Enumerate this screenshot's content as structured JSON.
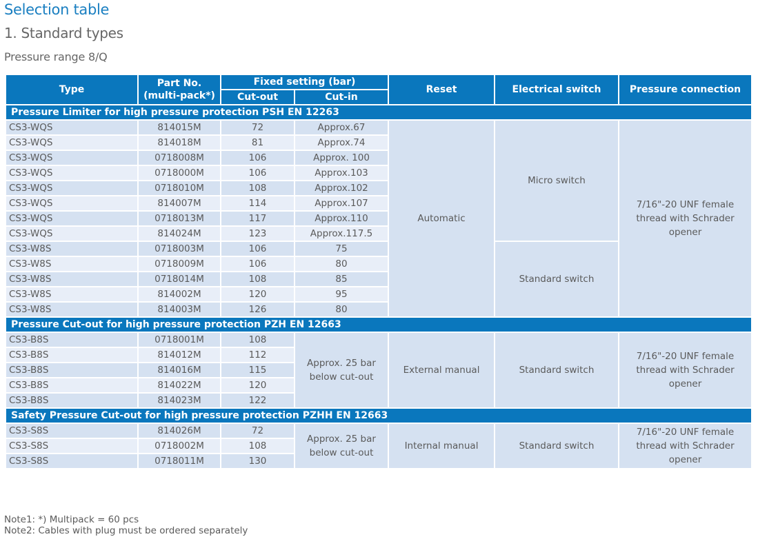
{
  "heading": {
    "title": "Selection table",
    "subtitle": "1. Standard types",
    "range": "Pressure range 8/Q"
  },
  "colors": {
    "brand_blue": "#0a77bd",
    "title_blue": "#1a7fc1",
    "row_dark": "#d5e1f1",
    "row_light": "#e8eef8"
  },
  "table": {
    "headers": {
      "type": "Type",
      "part_no": "Part No. (multi-pack*)",
      "fixed_setting": "Fixed setting (bar)",
      "cut_out": "Cut-out",
      "cut_in": "Cut-in",
      "reset": "Reset",
      "electrical_switch": "Electrical switch",
      "pressure_connection": "Pressure connection"
    },
    "sections": [
      {
        "title": "Pressure Limiter for high pressure protection PSH EN 12263",
        "reset": "Automatic",
        "connection": "7/16\"-20 UNF female thread with Schrader opener",
        "switch_groups": [
          {
            "label": "Micro switch",
            "rows": 8
          },
          {
            "label": "Standard switch",
            "rows": 5
          }
        ],
        "rows": [
          {
            "type": "CS3-WQS",
            "part": "814015M",
            "cut_out": "72",
            "cut_in": "Approx.67"
          },
          {
            "type": "CS3-WQS",
            "part": "814018M",
            "cut_out": "81",
            "cut_in": "Approx.74"
          },
          {
            "type": "CS3-WQS",
            "part": "0718008M",
            "cut_out": "106",
            "cut_in": "Approx. 100"
          },
          {
            "type": "CS3-WQS",
            "part": "0718000M",
            "cut_out": "106",
            "cut_in": "Approx.103"
          },
          {
            "type": "CS3-WQS",
            "part": "0718010M",
            "cut_out": "108",
            "cut_in": "Approx.102"
          },
          {
            "type": "CS3-WQS",
            "part": "814007M",
            "cut_out": "114",
            "cut_in": "Approx.107"
          },
          {
            "type": "CS3-WQS",
            "part": "0718013M",
            "cut_out": "117",
            "cut_in": "Approx.110"
          },
          {
            "type": "CS3-WQS",
            "part": "814024M",
            "cut_out": "123",
            "cut_in": "Approx.117.5"
          },
          {
            "type": "CS3-W8S",
            "part": "0718003M",
            "cut_out": "106",
            "cut_in": "75"
          },
          {
            "type": "CS3-W8S",
            "part": "0718009M",
            "cut_out": "106",
            "cut_in": "80"
          },
          {
            "type": "CS3-W8S",
            "part": "0718014M",
            "cut_out": "108",
            "cut_in": "85"
          },
          {
            "type": "CS3-W8S",
            "part": "814002M",
            "cut_out": "120",
            "cut_in": "95"
          },
          {
            "type": "CS3-W8S",
            "part": "814003M",
            "cut_out": "126",
            "cut_in": "80"
          }
        ]
      },
      {
        "title": "Pressure Cut-out for high pressure protection PZH EN 12663",
        "reset": "External manual",
        "switch": "Standard switch",
        "cut_in": "Approx. 25 bar below cut-out",
        "connection": "7/16\"-20 UNF female thread with Schrader opener",
        "rows": [
          {
            "type": "CS3-B8S",
            "part": "0718001M",
            "cut_out": "108"
          },
          {
            "type": "CS3-B8S",
            "part": "814012M",
            "cut_out": "112"
          },
          {
            "type": "CS3-B8S",
            "part": "814016M",
            "cut_out": "115"
          },
          {
            "type": "CS3-B8S",
            "part": "814022M",
            "cut_out": "120"
          },
          {
            "type": "CS3-B8S",
            "part": "814023M",
            "cut_out": "122"
          }
        ]
      },
      {
        "title": "Safety Pressure Cut-out for high pressure protection PZHH EN 12663",
        "reset": "Internal manual",
        "switch": "Standard switch",
        "cut_in": "Approx. 25 bar below cut-out",
        "connection": "7/16\"-20 UNF female thread with Schrader opener",
        "rows": [
          {
            "type": "CS3-S8S",
            "part": "814026M",
            "cut_out": "72"
          },
          {
            "type": "CS3-S8S",
            "part": "0718002M",
            "cut_out": "108"
          },
          {
            "type": "CS3-S8S",
            "part": "0718011M",
            "cut_out": "130"
          }
        ]
      }
    ]
  },
  "notes": [
    "Note1: *) Multipack = 60 pcs",
    "Note2: Cables with plug must be ordered separately"
  ]
}
